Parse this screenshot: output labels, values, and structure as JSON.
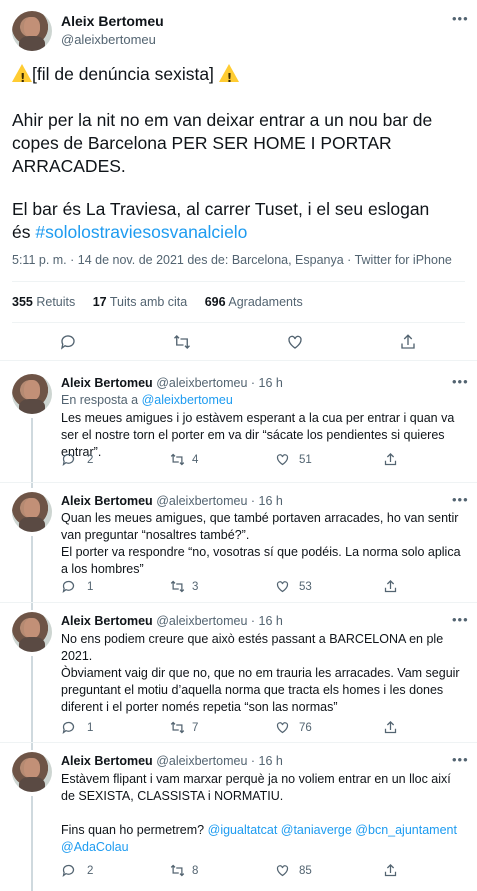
{
  "main_tweet": {
    "name": "Aleix Bertomeu",
    "handle": "@aleixbertomeu",
    "title_text": "[fil de denúncia sexista]",
    "para1": "Ahir per la nit no em van deixar entrar a un nou bar de copes de Barcelona PER SER HOME I PORTAR ARRACADES.",
    "para2_prefix": "El bar és La Traviesa, al carrer Tuset, i el seu eslogan és ",
    "hashtag": "#sololostraviesosvanalcielo",
    "meta": "5:11 p. m. · 14 de nov. de 2021 des de: Barcelona, Espanya · Twitter for iPhone",
    "retweets_count": "355",
    "retweets_label": "Retuits",
    "quotes_count": "17",
    "quotes_label": "Tuits amb cita",
    "likes_count": "696",
    "likes_label": "Agradaments"
  },
  "replies": [
    {
      "name": "Aleix Bertomeu",
      "handle_time": "@aleixbertomeu · 16 h",
      "in_reply_prefix": "En resposta a ",
      "in_reply_handle": "@aleixbertomeu",
      "text": "Les meues amigues i jo estàvem esperant a la cua per entrar i quan va ser el nostre torn el porter em va dir “sácate los pendientes si quieres entrar”.",
      "replies": "2",
      "retweets": "4",
      "likes": "51"
    },
    {
      "name": "Aleix Bertomeu",
      "handle_time": "@aleixbertomeu · 16 h",
      "text1": "Quan les meues amigues, que també portaven arracades, ho van sentir van preguntar “nosaltres també?”.",
      "text2": "El porter va respondre “no, vosotras sí que podéis. La norma solo aplica a los hombres”",
      "replies": "1",
      "retweets": "3",
      "likes": "53"
    },
    {
      "name": "Aleix Bertomeu",
      "handle_time": "@aleixbertomeu · 16 h",
      "text1": "No ens podiem creure que això estés passant a BARCELONA en ple 2021.",
      "text2": "Òbviament vaig dir que no, que no em trauria les arracades. Vam seguir preguntant el motiu d’aquella norma que tracta els homes i les dones diferent i el porter només repetia “son las normas”",
      "replies": "1",
      "retweets": "7",
      "likes": "76"
    },
    {
      "name": "Aleix Bertomeu",
      "handle_time": "@aleixbertomeu · 16 h",
      "text1": "Estàvem flipant i vam marxar perquè ja no voliem entrar en un lloc així de SEXISTA, CLASSISTA i NORMATIU.",
      "text2": "Fins quan ho permetrem?",
      "mentions": "@igualtatcat @taniaverge @bcn_ajuntament @AdaColau",
      "replies": "2",
      "retweets": "8",
      "likes": "85"
    }
  ],
  "colors": {
    "accent": "#1d9bf0",
    "muted": "#536471",
    "text": "#0f1419",
    "warning": "#ffcc32"
  }
}
